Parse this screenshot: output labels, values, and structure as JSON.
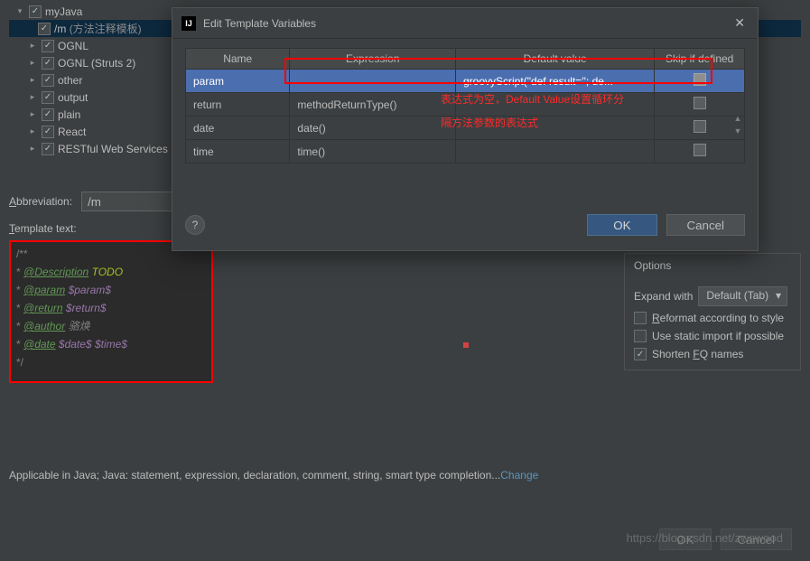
{
  "tree": {
    "parent": "myJava",
    "selected_item": "/m",
    "selected_desc": "(方法注释模板)",
    "items": [
      "OGNL",
      "OGNL (Struts 2)",
      "other",
      "output",
      "plain",
      "React",
      "RESTful Web Services"
    ]
  },
  "abbrev": {
    "label_pre": "A",
    "label_post": "bbreviation:",
    "value": "/m"
  },
  "template": {
    "label_pre": "T",
    "label_post": "emplate text:",
    "lines": {
      "l0": "/**",
      "l1": {
        "tag": "@Description",
        "rest": "TODO"
      },
      "l2": {
        "tag": "@param",
        "var": "$param$"
      },
      "l3": {
        "tag": "@return",
        "var": "$return$"
      },
      "l4": {
        "tag": "@author",
        "txt": "骆焕"
      },
      "l5": {
        "tag": "@date",
        "var1": "$date$",
        "var2": "$time$"
      },
      "l6": "*/"
    }
  },
  "applicable": {
    "text": "Applicable in Java; Java: statement, expression, declaration, comment, string, smart type completion...",
    "link": "Change"
  },
  "options": {
    "title": "Options",
    "expand_label": "Expand with",
    "expand_value": "Default (Tab)",
    "o1": {
      "pre": "R",
      "post": "eformat according to style"
    },
    "o2": "Use static import if possible",
    "o3": {
      "pre": "Shorten ",
      "u": "F",
      "post": "Q names"
    }
  },
  "dialog": {
    "title": "Edit Template Variables",
    "headers": {
      "name": "Name",
      "expr": "Expression",
      "def": "Default value",
      "skip": "Skip if defined"
    },
    "rows": [
      {
        "name": "param",
        "expr": "",
        "def": "groovyScript(\"def result=''; de..."
      },
      {
        "name": "return",
        "expr": "methodReturnType()",
        "def": ""
      },
      {
        "name": "date",
        "expr": "date()",
        "def": ""
      },
      {
        "name": "time",
        "expr": "time()",
        "def": ""
      }
    ],
    "red_text_1": "表达式为空，Default Value设置循环分",
    "red_text_2": "隔方法参数的表达式",
    "ok": "OK",
    "cancel": "Cancel"
  },
  "bottom": {
    "ok": "OK",
    "cancel": "Cancel"
  },
  "watermark": "https://blog.csdn.net/zwswood"
}
